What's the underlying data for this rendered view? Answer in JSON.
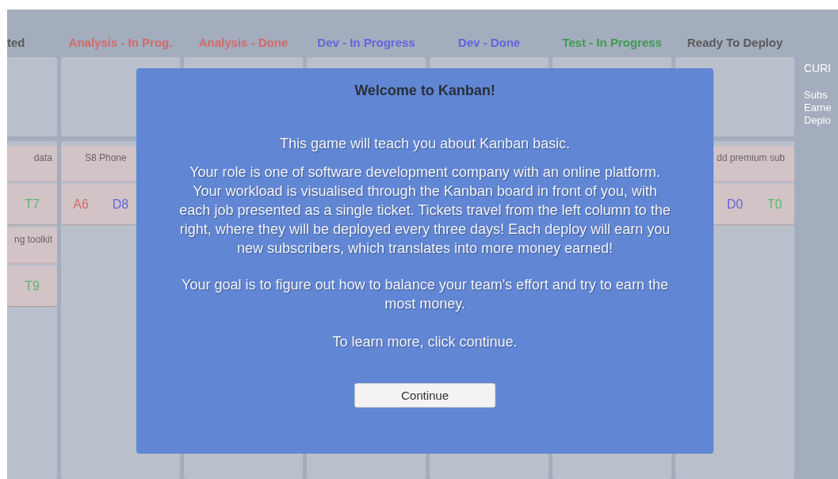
{
  "columns": [
    {
      "title": "ted",
      "color": "#5a5a5a",
      "cards": [
        {
          "title": "data",
          "tags": [
            {
              "kind": "test",
              "text": "T7"
            }
          ]
        },
        {
          "title": "ng toolkit",
          "tags": [
            {
              "kind": "test",
              "text": "T9"
            }
          ]
        }
      ]
    },
    {
      "title": "Analysis - In Prog.",
      "color": "#d46a6a",
      "cards": [
        {
          "title": "S8 Phone",
          "tags": [
            {
              "kind": "analysis",
              "text": "A6"
            },
            {
              "kind": "dev",
              "text": "D8"
            }
          ]
        }
      ]
    },
    {
      "title": "Analysis - Done",
      "color": "#d46a6a"
    },
    {
      "title": "Dev - In Progress",
      "color": "#6464dc"
    },
    {
      "title": "Dev - Done",
      "color": "#6464dc"
    },
    {
      "title": "Test - In Progress",
      "color": "#3f9a52"
    },
    {
      "title": "Ready To Deploy",
      "color": "#5a5a5a",
      "cards": [
        {
          "title": "dd premium sub",
          "tags": [
            {
              "kind": "dev",
              "text": "D0"
            },
            {
              "kind": "test",
              "text": "T0"
            }
          ]
        }
      ]
    }
  ],
  "side_panel": {
    "heading": "CURI",
    "stats": [
      "Subs",
      "Earne",
      "Deplo"
    ]
  },
  "dialog": {
    "title": "Welcome to Kanban!",
    "paragraphs": [
      "This game will teach you about Kanban basic.",
      "Your role is one of software development company with an online platform. Your workload is visualised through the Kanban board in front of you, with each job presented as a single ticket. Tickets travel from the left column to the right, where they will be deployed every three days! Each deploy will earn you new subscribers, which translates into more money earned!",
      "Your goal is to figure out how to balance your team's effort and try to earn the most money.",
      "To learn more, click continue."
    ],
    "button": "Continue"
  }
}
